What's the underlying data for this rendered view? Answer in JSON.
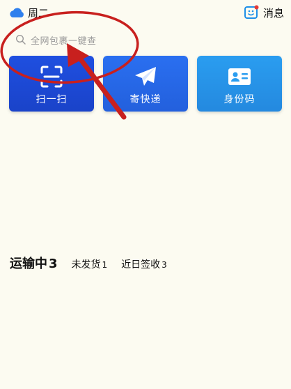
{
  "header": {
    "weekday": "周二",
    "message_label": "消息",
    "weather_icon": "cloud-icon",
    "message_icon": "smiley-face-icon"
  },
  "search": {
    "placeholder": "全网包裹一键查",
    "icon": "search-icon"
  },
  "actions": [
    {
      "label": "扫一扫",
      "icon": "scan-icon",
      "color": "#1F4FE0"
    },
    {
      "label": "寄快递",
      "icon": "paper-plane-icon",
      "color": "#2A6FF0"
    },
    {
      "label": "身份码",
      "icon": "id-card-icon",
      "color": "#2A9DF0"
    }
  ],
  "tabs": [
    {
      "label": "运输中",
      "count": "3"
    },
    {
      "label": "未发货",
      "count": "1"
    },
    {
      "label": "近日签收",
      "count": "3"
    }
  ],
  "colors": {
    "background": "#FCFBF1",
    "annotation": "#C8201E",
    "notification_dot": "#E53935"
  }
}
